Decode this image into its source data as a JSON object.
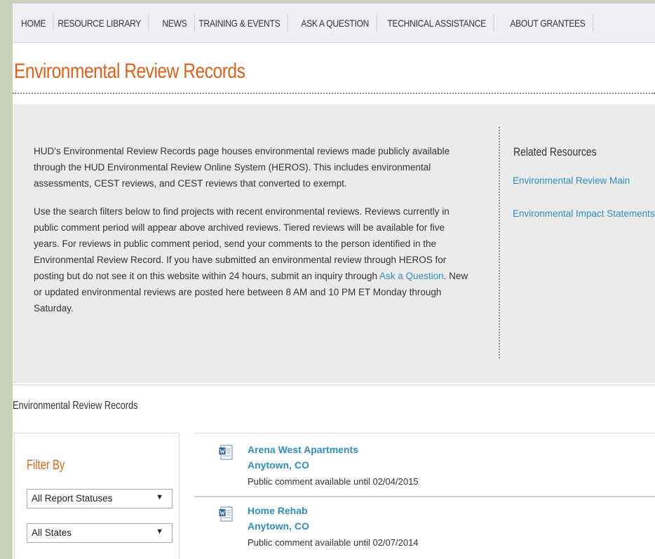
{
  "nav": {
    "items": [
      "HOME",
      "RESOURCE LIBRARY",
      "NEWS",
      "TRAINING & EVENTS",
      "ASK A QUESTION",
      "TECHNICAL ASSISTANCE",
      "ABOUT GRANTEES"
    ]
  },
  "page": {
    "title": "Environmental Review Records"
  },
  "intro": {
    "paragraph1": "HUD's Environmental Review Records page houses environmental reviews made publicly available through the HUD Environmental Review Online System (HEROS). This includes environmental assessments, CEST reviews, and CEST reviews that converted to exempt.",
    "paragraph2_before_link": "Use the search filters below to find projects with recent environmental reviews. Reviews currently in public comment period will appear above archived reviews. Tiered reviews will be available for five years. For reviews in public comment period, send your comments to the person identified in the Environmental Review Record. If you have submitted an environmental review through HEROS for posting but do not see it on this website within 24 hours, submit an inquiry through ",
    "paragraph2_link": "Ask a Question",
    "paragraph2_after_link": ". New or updated environmental reviews are posted here between 8 AM and 10 PM ET Monday through Saturday."
  },
  "related": {
    "title": "Related Resources",
    "links": [
      "Environmental Review Main",
      "Environmental Impact Statements"
    ]
  },
  "records": {
    "section_title": "Environmental Review Records",
    "filter_title": "Filter By",
    "filters": [
      {
        "selected": "All Report Statuses"
      },
      {
        "selected": "All States"
      }
    ],
    "results": [
      {
        "title": "Arena West Apartments",
        "location": "Anytown, CO",
        "status": "Public comment available until 02/04/2015"
      },
      {
        "title": "Home Rehab",
        "location": "Anytown, CO",
        "status": "Public comment available until 02/07/2014"
      }
    ]
  },
  "colors": {
    "accent_orange": "#e0621a",
    "link_blue": "#2e8fbf",
    "outer_frame": "#c9d1bd",
    "nav_bg": "#efeef3",
    "intro_bg": "#ebebeb"
  },
  "icons": {
    "result_icon": "word-document-icon",
    "dropdown_icon": "triangle-down-icon"
  }
}
